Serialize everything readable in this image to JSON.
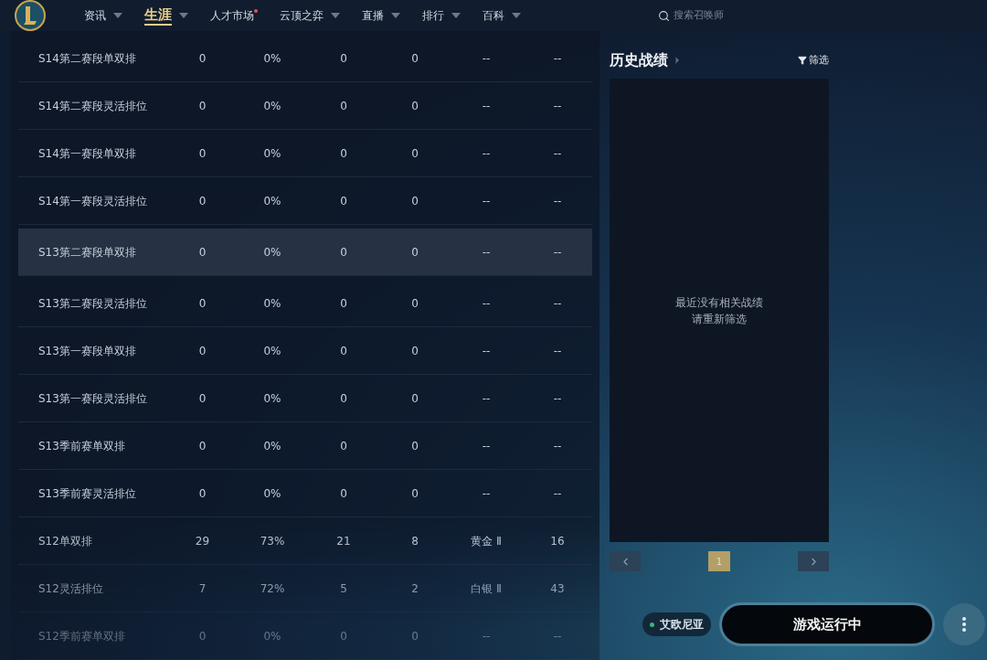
{
  "nav": {
    "items": [
      {
        "label": "资讯",
        "dropdown": true,
        "selected": false,
        "dot": false
      },
      {
        "label": "生涯",
        "dropdown": true,
        "selected": true,
        "dot": false
      },
      {
        "label": "人才市场",
        "dropdown": false,
        "selected": false,
        "dot": true
      },
      {
        "label": "云顶之弈",
        "dropdown": true,
        "selected": false,
        "dot": false
      },
      {
        "label": "直播",
        "dropdown": true,
        "selected": false,
        "dot": false
      },
      {
        "label": "排行",
        "dropdown": true,
        "selected": false,
        "dot": false
      },
      {
        "label": "百科",
        "dropdown": true,
        "selected": false,
        "dot": false
      }
    ],
    "search": {
      "placeholder": "搜索召唤师"
    }
  },
  "table": {
    "rows": [
      {
        "highlighted": false,
        "cells": [
          "S14第二赛段单双排",
          "0",
          "0%",
          "0",
          "0",
          "--",
          "--"
        ]
      },
      {
        "highlighted": false,
        "cells": [
          "S14第二赛段灵活排位",
          "0",
          "0%",
          "0",
          "0",
          "--",
          "--"
        ]
      },
      {
        "highlighted": false,
        "cells": [
          "S14第一赛段单双排",
          "0",
          "0%",
          "0",
          "0",
          "--",
          "--"
        ]
      },
      {
        "highlighted": false,
        "cells": [
          "S14第一赛段灵活排位",
          "0",
          "0%",
          "0",
          "0",
          "--",
          "--"
        ]
      },
      {
        "highlighted": true,
        "cells": [
          "S13第二赛段单双排",
          "0",
          "0%",
          "0",
          "0",
          "--",
          "--"
        ]
      },
      {
        "highlighted": false,
        "cells": [
          "S13第二赛段灵活排位",
          "0",
          "0%",
          "0",
          "0",
          "--",
          "--"
        ]
      },
      {
        "highlighted": false,
        "cells": [
          "S13第一赛段单双排",
          "0",
          "0%",
          "0",
          "0",
          "--",
          "--"
        ]
      },
      {
        "highlighted": false,
        "cells": [
          "S13第一赛段灵活排位",
          "0",
          "0%",
          "0",
          "0",
          "--",
          "--"
        ]
      },
      {
        "highlighted": false,
        "cells": [
          "S13季前赛单双排",
          "0",
          "0%",
          "0",
          "0",
          "--",
          "--"
        ]
      },
      {
        "highlighted": false,
        "cells": [
          "S13季前赛灵活排位",
          "0",
          "0%",
          "0",
          "0",
          "--",
          "--"
        ]
      },
      {
        "highlighted": false,
        "cells": [
          "S12单双排",
          "29",
          "73%",
          "21",
          "8",
          "黄金 Ⅱ",
          "16"
        ]
      },
      {
        "highlighted": false,
        "cells": [
          "S12灵活排位",
          "7",
          "72%",
          "5",
          "2",
          "白银 Ⅱ",
          "43"
        ]
      },
      {
        "highlighted": false,
        "cells": [
          "S12季前赛单双排",
          "0",
          "0%",
          "0",
          "0",
          "--",
          "--"
        ]
      }
    ]
  },
  "history": {
    "title": "历史战绩",
    "filter": "筛选",
    "empty_lines": [
      "最近没有相关战绩",
      "请重新筛选"
    ],
    "pagination": {
      "pages": [
        {
          "label": "1",
          "selected": true
        }
      ]
    }
  },
  "footer": {
    "server": "艾欧尼亚",
    "play": "游戏运行中"
  }
}
